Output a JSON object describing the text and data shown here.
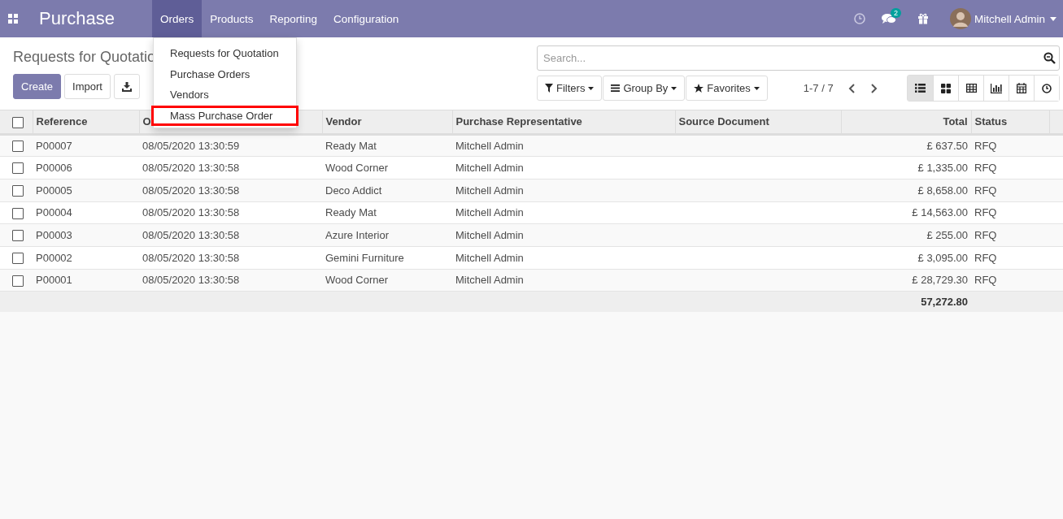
{
  "navbar": {
    "app_name": "Purchase",
    "menus": [
      {
        "label": "Orders",
        "selected": true
      },
      {
        "label": "Products",
        "selected": false
      },
      {
        "label": "Reporting",
        "selected": false
      },
      {
        "label": "Configuration",
        "selected": false
      }
    ],
    "messages_badge": "2",
    "user": "Mitchell Admin"
  },
  "dropdown": {
    "items": [
      {
        "label": "Requests for Quotation",
        "highlighted": false
      },
      {
        "label": "Purchase Orders",
        "highlighted": false
      },
      {
        "label": "Vendors",
        "highlighted": false
      },
      {
        "label": "Mass Purchase Order",
        "highlighted": true
      }
    ]
  },
  "control_panel": {
    "title": "Requests for Quotatio",
    "buttons": [
      {
        "label": "Create",
        "kind": "primary"
      },
      {
        "label": "Import",
        "kind": "secondary"
      }
    ],
    "search": {
      "placeholder": "Search..."
    },
    "search_buttons": [
      {
        "label": "Filters",
        "kind": "filter"
      },
      {
        "label": "Group By",
        "kind": "group"
      },
      {
        "label": "Favorites",
        "kind": "star"
      }
    ],
    "pager": "1-7 / 7",
    "views": [
      {
        "kind": "list",
        "selected": true
      },
      {
        "kind": "kanban",
        "selected": false
      },
      {
        "kind": "pivot",
        "selected": false
      },
      {
        "kind": "graph",
        "selected": false
      },
      {
        "kind": "calendar",
        "selected": false
      },
      {
        "kind": "activity",
        "selected": false
      }
    ]
  },
  "table": {
    "all_selected": false,
    "columns": [
      "Reference",
      "O",
      "Vendor",
      "Purchase Representative",
      "Source Document",
      "Total",
      "Status"
    ],
    "rows": [
      {
        "checked": false,
        "cells": [
          "P00007",
          "08/05/2020 13:30:59",
          "Ready Mat",
          "Mitchell Admin",
          "",
          "£ 637.50",
          "RFQ"
        ]
      },
      {
        "checked": false,
        "cells": [
          "P00006",
          "08/05/2020 13:30:58",
          "Wood Corner",
          "Mitchell Admin",
          "",
          "£ 1,335.00",
          "RFQ"
        ]
      },
      {
        "checked": false,
        "cells": [
          "P00005",
          "08/05/2020 13:30:58",
          "Deco Addict",
          "Mitchell Admin",
          "",
          "£ 8,658.00",
          "RFQ"
        ]
      },
      {
        "checked": false,
        "cells": [
          "P00004",
          "08/05/2020 13:30:58",
          "Ready Mat",
          "Mitchell Admin",
          "",
          "£ 14,563.00",
          "RFQ"
        ]
      },
      {
        "checked": false,
        "cells": [
          "P00003",
          "08/05/2020 13:30:58",
          "Azure Interior",
          "Mitchell Admin",
          "",
          "£ 255.00",
          "RFQ"
        ]
      },
      {
        "checked": false,
        "cells": [
          "P00002",
          "08/05/2020 13:30:58",
          "Gemini Furniture",
          "Mitchell Admin",
          "",
          "£ 3,095.00",
          "RFQ"
        ]
      },
      {
        "checked": false,
        "cells": [
          "P00001",
          "08/05/2020 13:30:58",
          "Wood Corner",
          "Mitchell Admin",
          "",
          "£ 28,729.30",
          "RFQ"
        ]
      }
    ],
    "total": "57,272.80"
  }
}
